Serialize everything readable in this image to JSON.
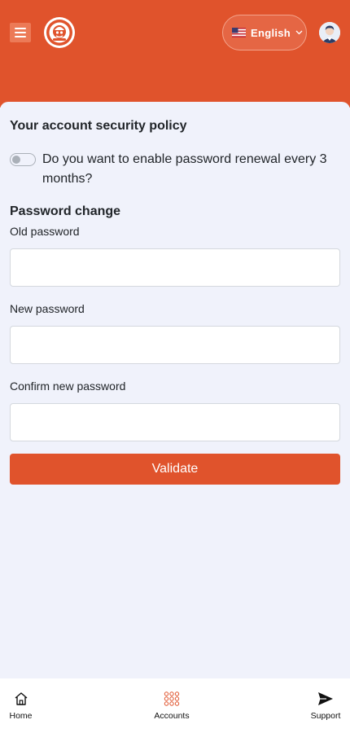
{
  "header": {
    "language_label": "English",
    "language_flag": "us-flag-icon",
    "brand_color": "#e0532c"
  },
  "security": {
    "title": "Your account security policy",
    "renewal_question": "Do you want to enable password renewal every 3 months?",
    "renewal_enabled": false
  },
  "password_change": {
    "title": "Password change",
    "old_label": "Old password",
    "old_value": "",
    "new_label": "New password",
    "new_value": "",
    "confirm_label": "Confirm new password",
    "confirm_value": "",
    "validate_label": "Validate"
  },
  "bottom_nav": {
    "items": [
      {
        "label": "Home",
        "icon": "home-icon"
      },
      {
        "label": "Accounts",
        "icon": "accounts-grid-icon"
      },
      {
        "label": "Support",
        "icon": "send-icon"
      }
    ]
  }
}
